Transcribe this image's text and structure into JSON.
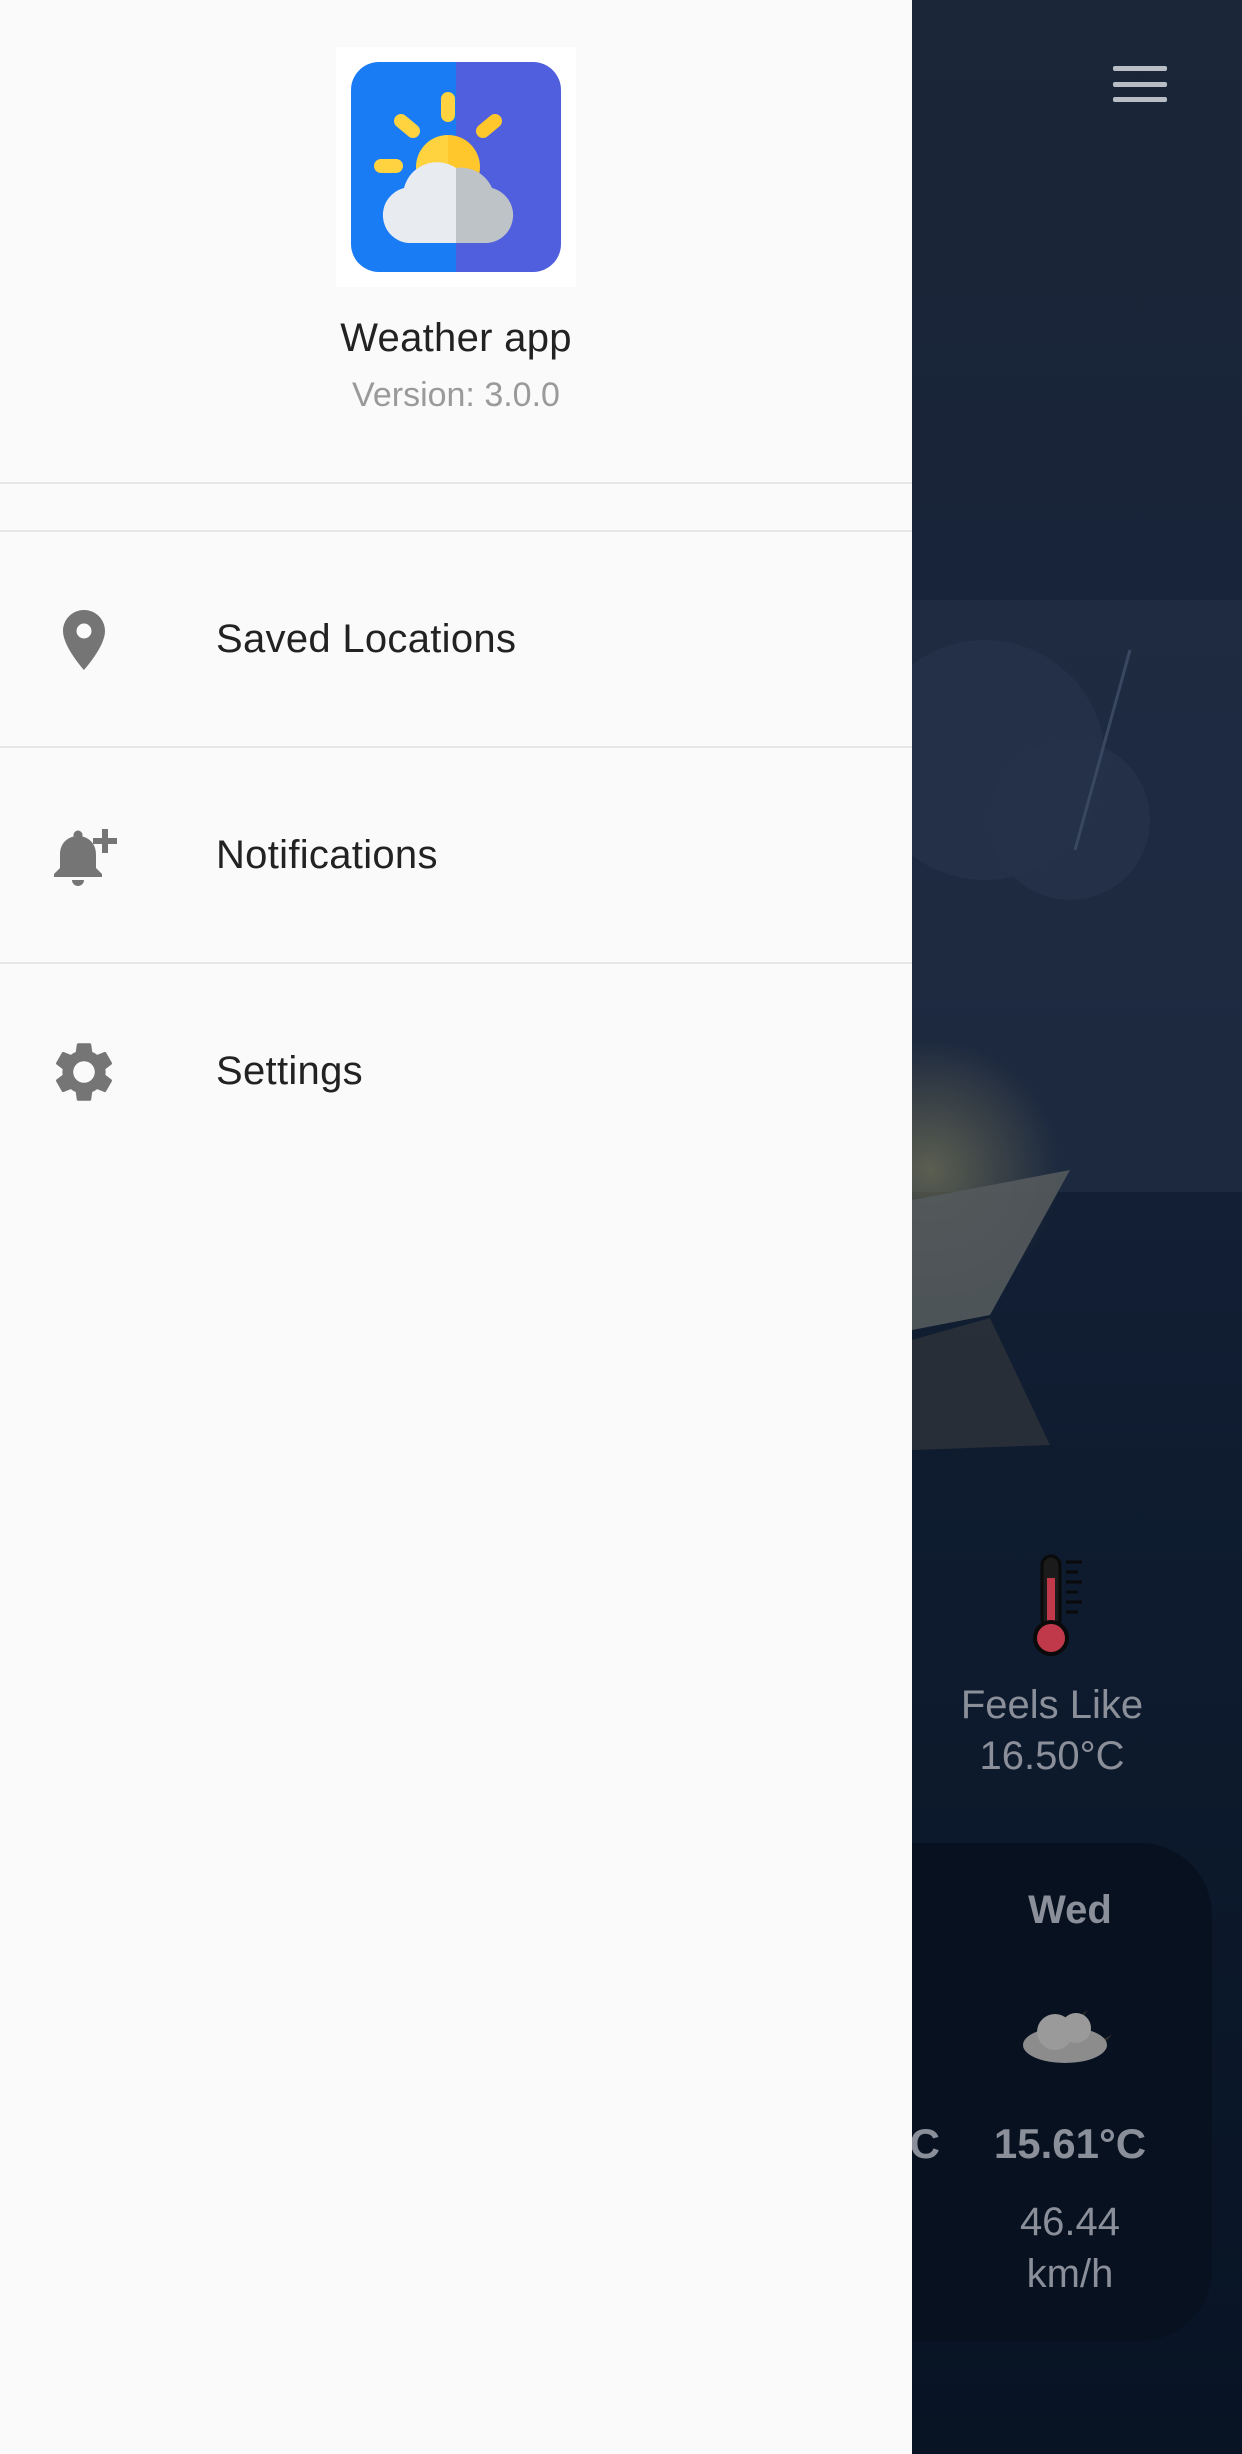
{
  "drawer": {
    "app_name": "Weather app",
    "app_version": "Version: 3.0.0",
    "items": [
      {
        "label": "Saved Locations",
        "icon": "location-pin-icon"
      },
      {
        "label": "Notifications",
        "icon": "bell-plus-icon"
      },
      {
        "label": "Settings",
        "icon": "gear-icon"
      }
    ]
  },
  "background": {
    "menu_icon": "hamburger-menu-icon",
    "feels_like": {
      "label": "Feels Like",
      "value": "16.50°C",
      "icon": "thermometer-icon"
    },
    "forecast": {
      "day": "Wed",
      "icon": "cloudy-night-icon",
      "temp": "15.61°C",
      "partial_unit": "C",
      "wind_value": "46.44",
      "wind_unit": "km/h"
    }
  },
  "colors": {
    "drawer_bg": "#fafafa",
    "logo_blue": "#1a7cf5",
    "logo_purple": "#4f5fdd",
    "sun_yellow": "#ffd23f",
    "icon_gray": "#757575",
    "screen_bg_dark": "#0b1626"
  }
}
